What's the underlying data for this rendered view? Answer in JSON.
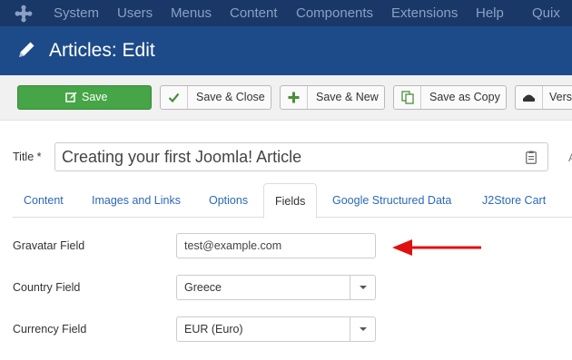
{
  "menubar": {
    "items": [
      "System",
      "Users",
      "Menus",
      "Content",
      "Components",
      "Extensions",
      "Help"
    ],
    "right_item": "Quix"
  },
  "titlebar": {
    "title": "Articles: Edit"
  },
  "toolbar": {
    "buttons": [
      {
        "label": "Save",
        "icon": "edit-icon"
      },
      {
        "label": "Save & Close",
        "icon": "check-icon"
      },
      {
        "label": "Save & New",
        "icon": "plus-icon"
      },
      {
        "label": "Save as Copy",
        "icon": "copy-icon"
      },
      {
        "label": "Versi",
        "icon": "versions-icon"
      }
    ],
    "save_color": "#46a546"
  },
  "title_field": {
    "label": "Title *",
    "value": "Creating your first Joomla! Article",
    "edge_glyph": "A"
  },
  "tabs": {
    "items": [
      "Content",
      "Images and Links",
      "Options",
      "Fields",
      "Google Structured Data",
      "J2Store Cart"
    ],
    "active": "Fields"
  },
  "fields": {
    "gravatar": {
      "label": "Gravatar Field",
      "value": "test@example.com"
    },
    "country": {
      "label": "Country Field",
      "value": "Greece"
    },
    "currency": {
      "label": "Currency Field",
      "value": "EUR (Euro)"
    }
  },
  "colors": {
    "menubar_bg": "#1a3867",
    "titlebar_bg": "#1d4b89",
    "link": "#2a69b8",
    "annotation_arrow": "#e01010"
  }
}
